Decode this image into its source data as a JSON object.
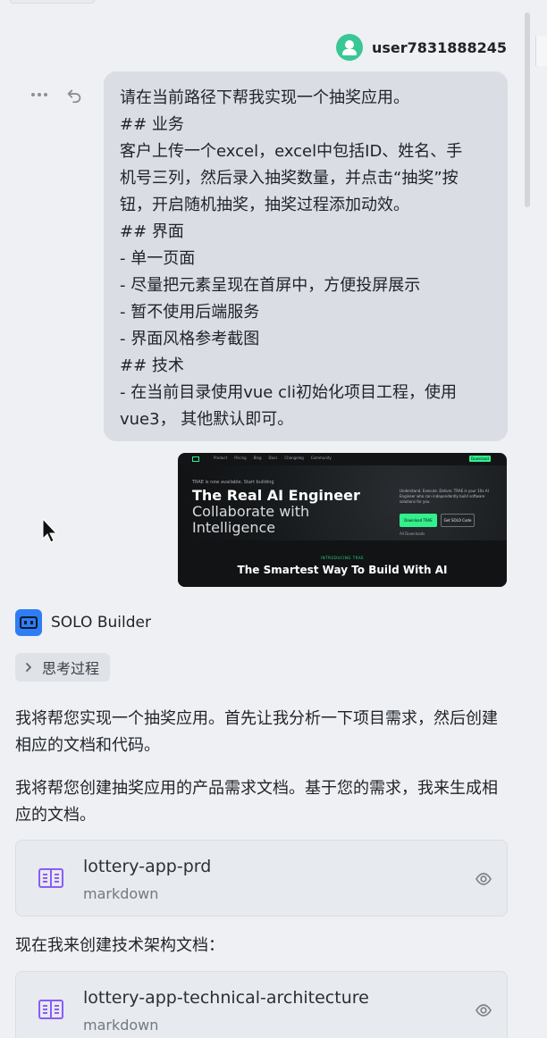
{
  "user": {
    "name": "user7831888245"
  },
  "message": {
    "text": "请在当前路径下帮我实现一个抽奖应用。\n## 业务\n客户上传一个excel，excel中包括ID、姓名、手\n机号三列，然后录入抽奖数量，并点击“抽奖”按\n钮，开启随机抽奖，抽奖过程添加动效。\n## 界面\n- 单一页面\n- 尽量把元素呈现在首屏中，方便投屏展示\n- 暂不使用后端服务\n- 界面风格参考截图\n## 技术\n- 在当前目录使用vue cli初始化项目工程，使用\nvue3， 其他默认即可。"
  },
  "attachment": {
    "hero_title_1": "The Real AI Engineer",
    "hero_title_2": "Collaborate with",
    "hero_title_3": "Intelligence",
    "intro_tag": "INTRODUCING TRAE",
    "headline": "The Smartest Way To Build With AI",
    "nav_items": [
      "Product",
      "Pricing",
      "Blog",
      "Docs",
      "Changelog",
      "Community"
    ],
    "download_label": "Download",
    "small_line": "TRAE is now available. Start building",
    "right_copy": "Understand. Execute. Deliver. TRAE is your 10x AI Engineer who can independently build software solutions for you.",
    "cta_primary": "Download TRAE",
    "cta_secondary": "Get SOLO Code",
    "mini_link": "All Downloads"
  },
  "assistant": {
    "name": "SOLO Builder",
    "thinking_label": "思考过程",
    "response_1": "我将帮您实现一个抽奖应用。首先让我分析一下项目需求，然后创建相应的文档和代码。",
    "response_2": "我将帮您创建抽奖应用的产品需求文档。基于您的需求，我来生成相应的文档。",
    "response_3": "现在我来创建技术架构文档："
  },
  "files": [
    {
      "title": "lottery-app-prd",
      "type": "markdown"
    },
    {
      "title": "lottery-app-technical-architecture",
      "type": "markdown"
    }
  ],
  "colors": {
    "background": "#eef0f3",
    "bubble": "#dadde3",
    "avatar": "#38c795",
    "accent_blue": "#2f7df6",
    "doc_icon": "#8b5cf6",
    "trae_green": "#32f08c"
  },
  "icons": {
    "more": "more-icon",
    "undo": "undo-icon",
    "chevron": "chevron-right-icon",
    "document": "document-icon",
    "preview": "eye-icon",
    "pointer": "cursor-icon"
  }
}
